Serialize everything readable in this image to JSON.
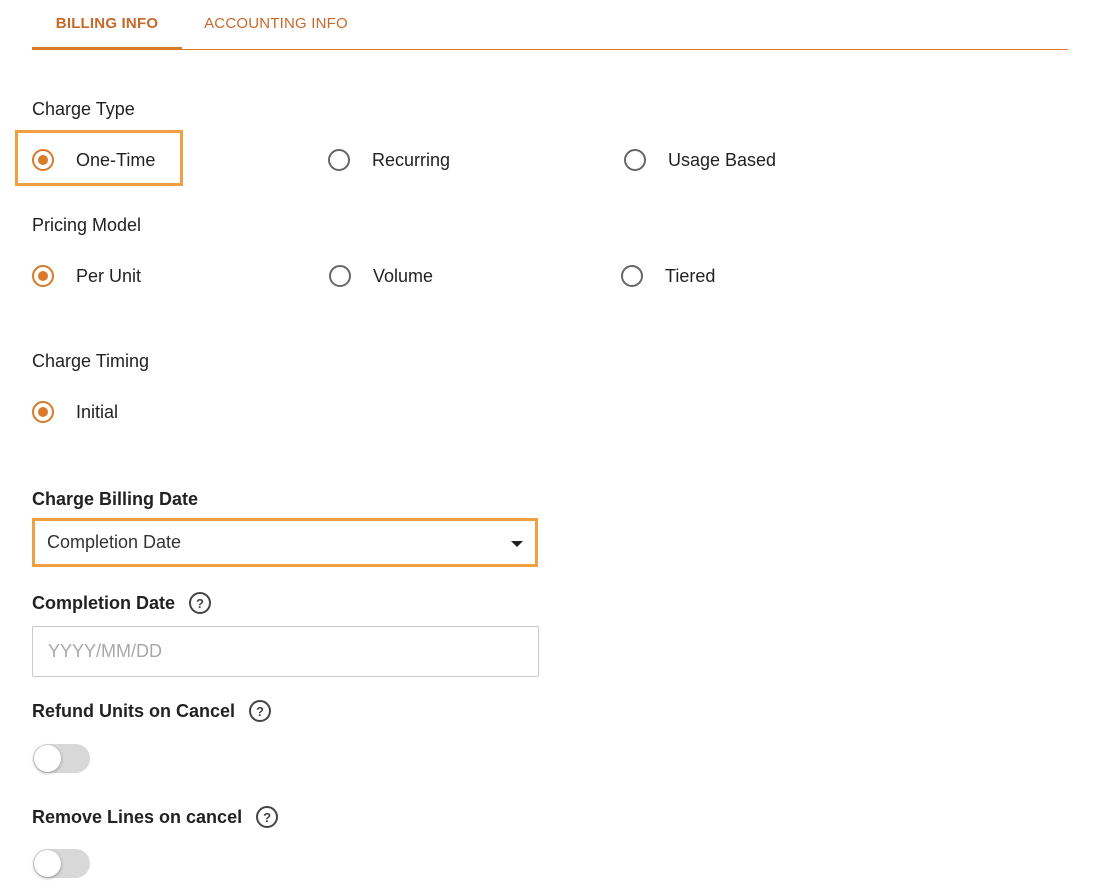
{
  "tabs": [
    {
      "label": "BILLING INFO",
      "active": true
    },
    {
      "label": "ACCOUNTING INFO",
      "active": false
    }
  ],
  "charge_type": {
    "label": "Charge Type",
    "options": [
      {
        "label": "One-Time",
        "checked": true
      },
      {
        "label": "Recurring",
        "checked": false
      },
      {
        "label": "Usage Based",
        "checked": false
      }
    ]
  },
  "pricing_model": {
    "label": "Pricing Model",
    "options": [
      {
        "label": "Per Unit",
        "checked": true
      },
      {
        "label": "Volume",
        "checked": false
      },
      {
        "label": "Tiered",
        "checked": false
      }
    ]
  },
  "charge_timing": {
    "label": "Charge Timing",
    "options": [
      {
        "label": "Initial",
        "checked": true
      }
    ]
  },
  "charge_billing_date": {
    "label": "Charge Billing Date",
    "selected": "Completion Date"
  },
  "completion_date": {
    "label": "Completion Date",
    "value": "",
    "placeholder": "YYYY/MM/DD"
  },
  "refund_units": {
    "label": "Refund Units on Cancel",
    "enabled": false
  },
  "remove_lines": {
    "label": "Remove Lines on cancel",
    "enabled": false
  },
  "icons": {
    "help": "?"
  },
  "colors": {
    "accent": "#d97a2b",
    "focus": "#f0a040",
    "toggle_off": "#d8d8d8"
  }
}
